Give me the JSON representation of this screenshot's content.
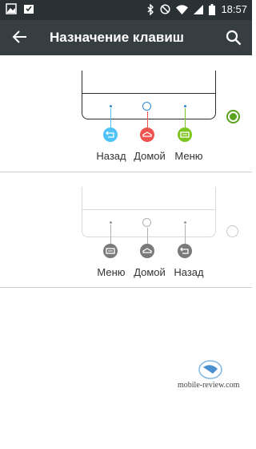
{
  "status_bar": {
    "left_icons": [
      "image-icon",
      "checklist-icon"
    ],
    "right_icons": [
      "bluetooth-icon",
      "do-not-disturb-icon",
      "wifi-icon",
      "signal-icon",
      "battery-icon"
    ],
    "time": "18:57"
  },
  "toolbar": {
    "title": "Назначение клавиш",
    "back_icon": "arrow-back-icon",
    "search_icon": "search-icon"
  },
  "options": [
    {
      "selected": true,
      "buttons": [
        {
          "label": "Назад",
          "icon": "back-icon",
          "color": "#4fc3f7"
        },
        {
          "label": "Домой",
          "icon": "home-icon",
          "color": "#ef5350"
        },
        {
          "label": "Меню",
          "icon": "menu-icon",
          "color": "#7cc520"
        }
      ]
    },
    {
      "selected": false,
      "buttons": [
        {
          "label": "Меню",
          "icon": "menu-icon",
          "color": "#7a7a7a"
        },
        {
          "label": "Домой",
          "icon": "home-icon",
          "color": "#7a7a7a"
        },
        {
          "label": "Назад",
          "icon": "back-icon",
          "color": "#7a7a7a"
        }
      ]
    }
  ],
  "colors": {
    "radio_selected": "#5aa31e",
    "radio_unselected": "#c8c8c8",
    "toolbar": "#373e42",
    "status_bar": "#2a3134"
  },
  "watermark": "mobile-review.com"
}
